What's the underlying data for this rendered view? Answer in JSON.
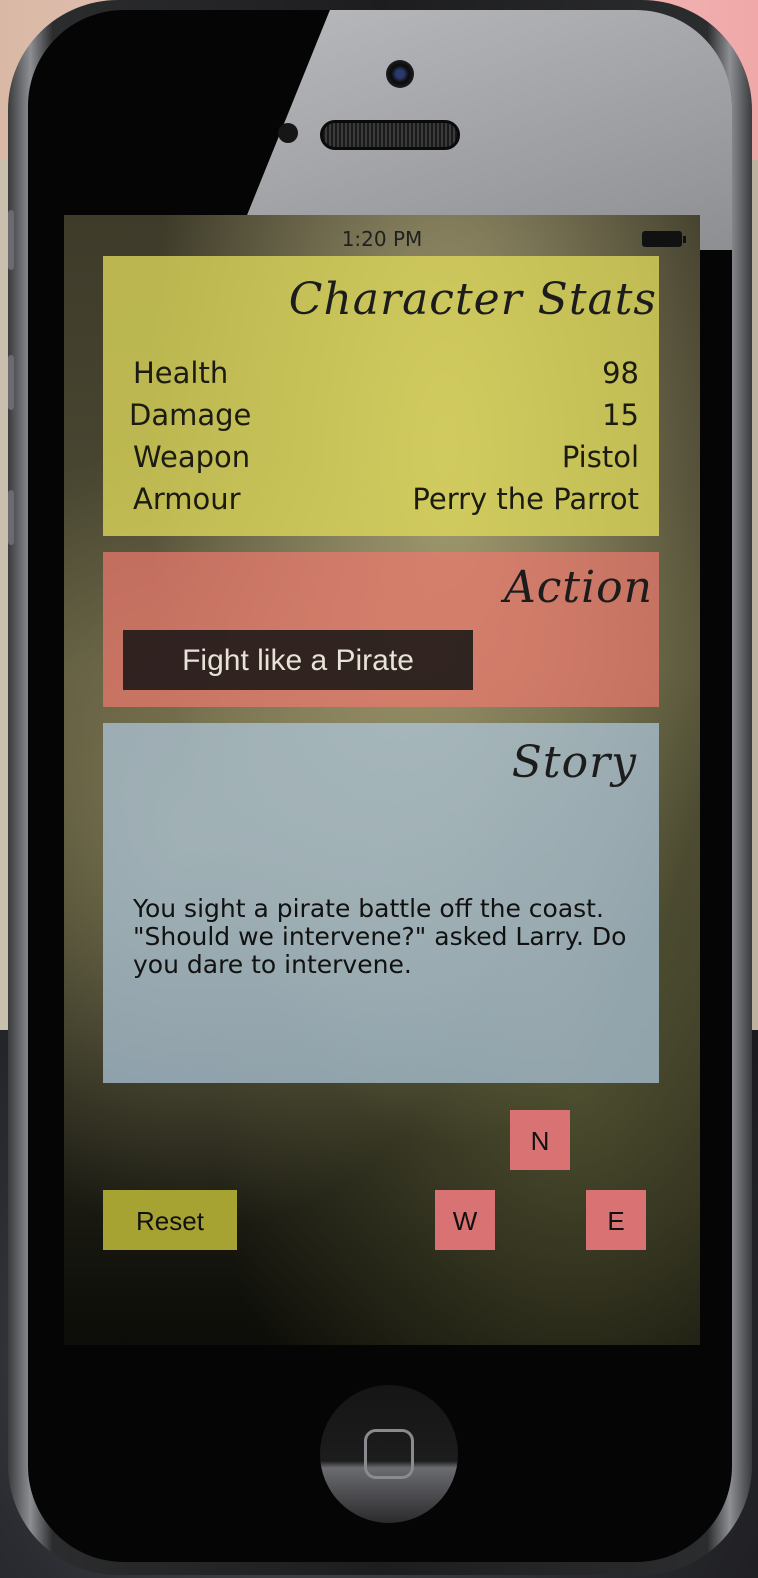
{
  "status_bar": {
    "time": "1:20 PM"
  },
  "stats": {
    "title": "Character Stats",
    "rows": [
      {
        "label": "Health",
        "value": "98"
      },
      {
        "label": "Damage",
        "value": "15"
      },
      {
        "label": "Weapon",
        "value": "Pistol"
      },
      {
        "label": "Armour",
        "value": "Perry the Parrot"
      }
    ]
  },
  "action": {
    "title": "Action",
    "button_label": "Fight like a Pirate"
  },
  "story": {
    "title": "Story",
    "text": "You sight a pirate battle off the coast. \"Should we intervene?\" asked Larry. Do you dare to intervene."
  },
  "controls": {
    "reset_label": "Reset",
    "north_label": "N",
    "west_label": "W",
    "east_label": "E"
  },
  "colors": {
    "stats_panel": "#ded85a",
    "action_panel": "#eb786e",
    "story_panel": "#afc8dc",
    "reset_button": "#a7a332",
    "direction_button": "#d97272",
    "action_button": "#141414"
  },
  "icons": [
    "battery-icon",
    "home-button-icon",
    "camera-icon",
    "speaker-grille-icon"
  ]
}
